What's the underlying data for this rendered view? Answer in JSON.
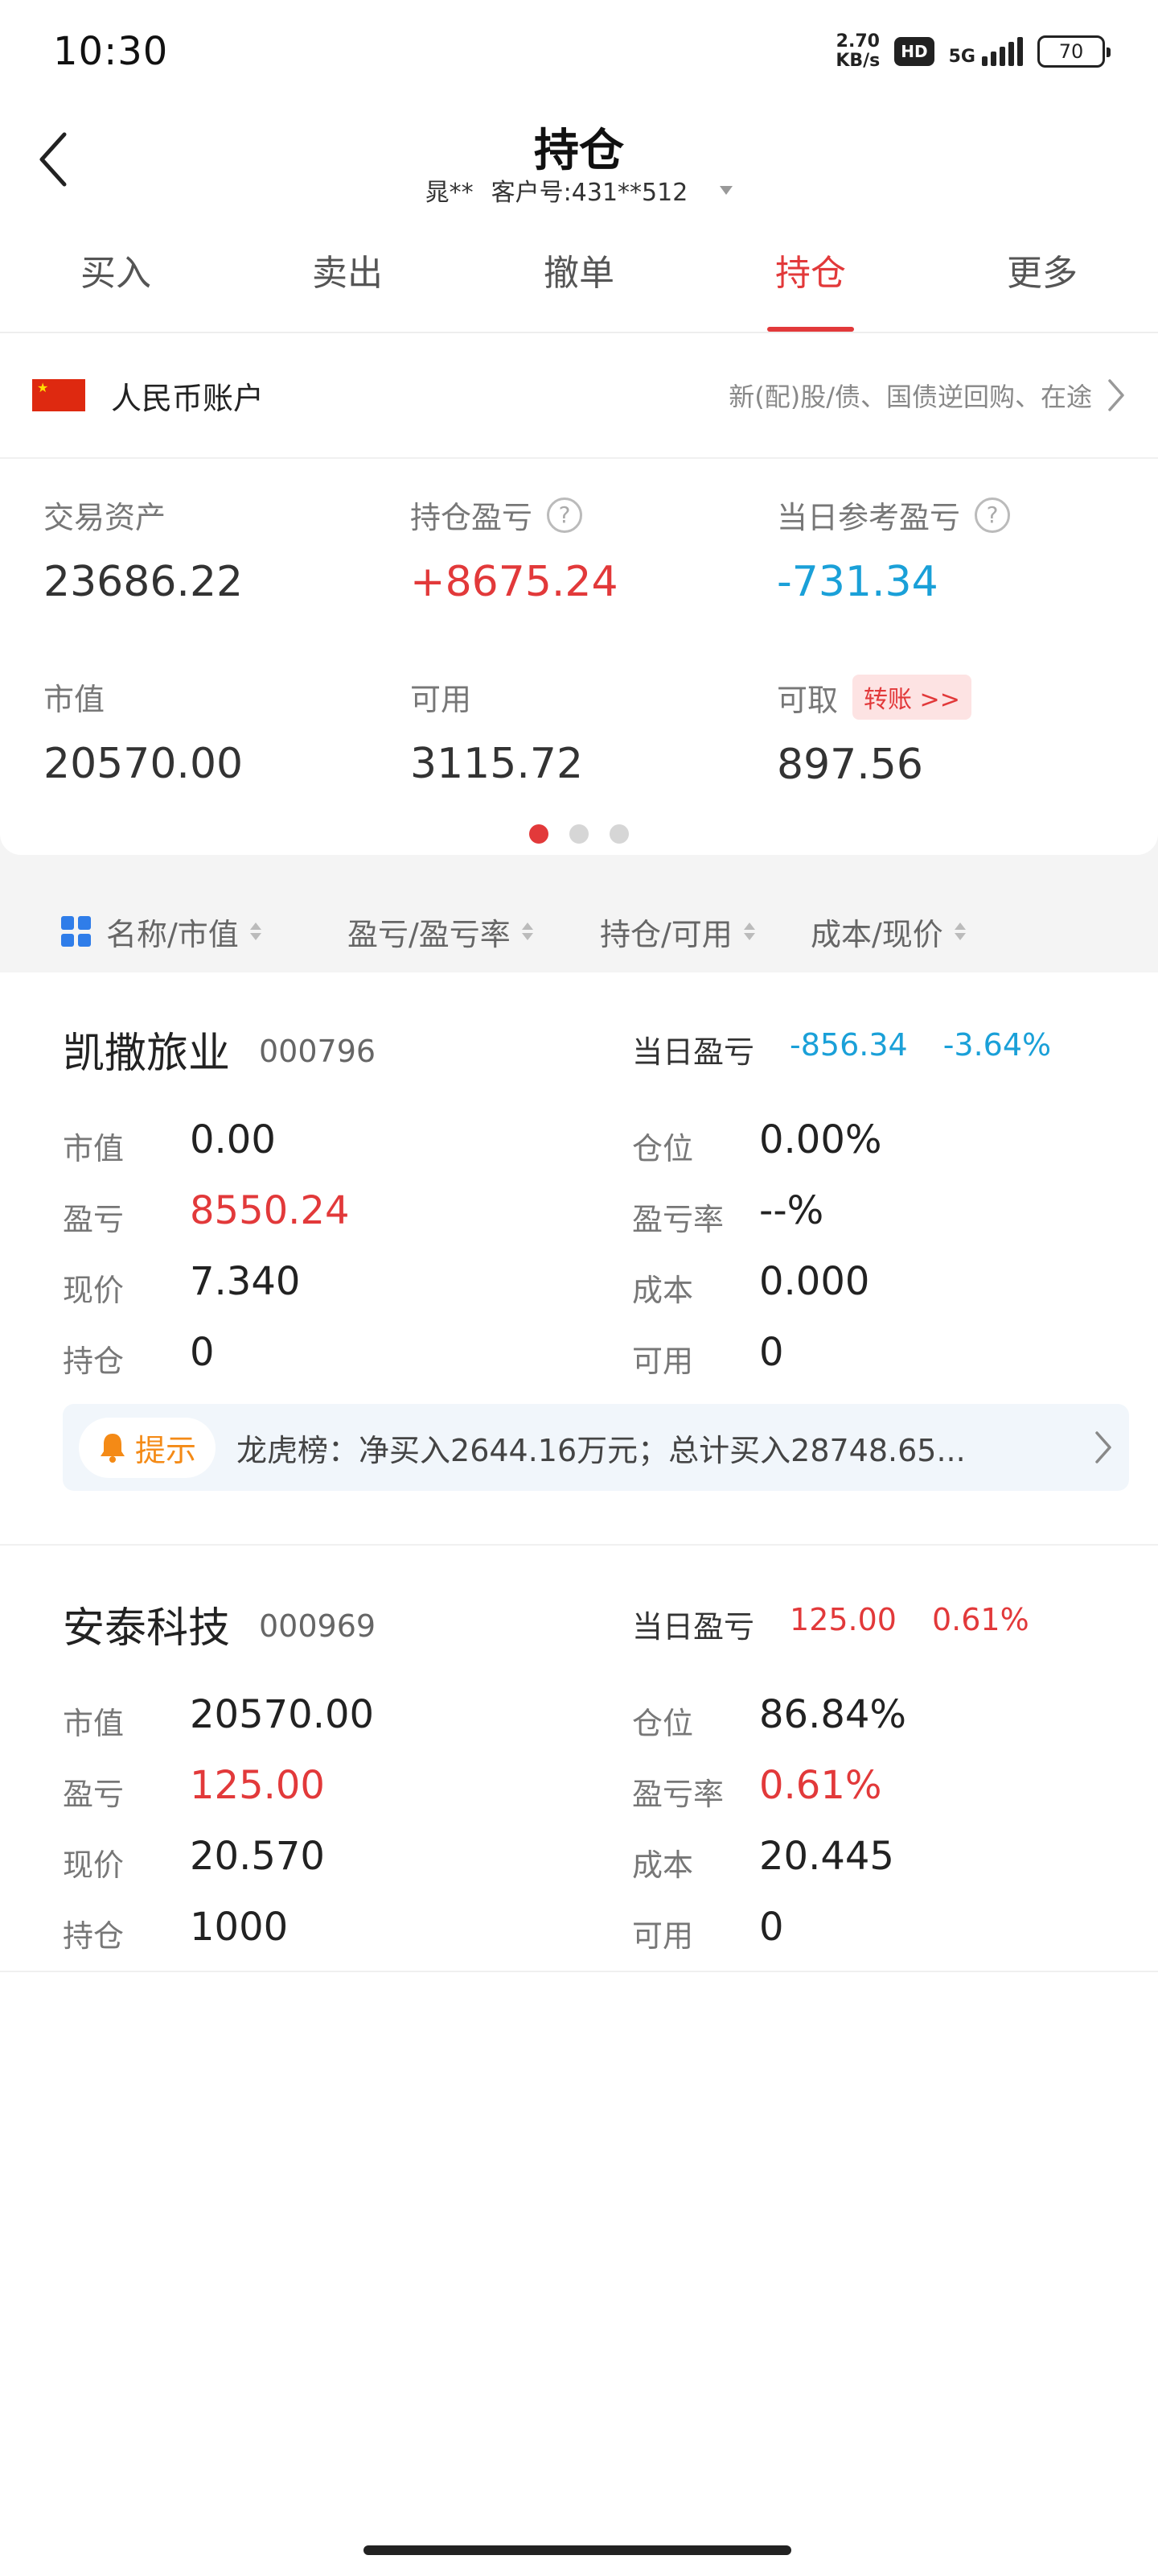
{
  "status_bar": {
    "time": "10:30",
    "net_speed_value": "2.70",
    "net_speed_unit": "KB/s",
    "hd": "HD",
    "signal": "5G",
    "battery": "70"
  },
  "header": {
    "title": "持仓",
    "user": "晁**",
    "customer_no": "客户号:431**512"
  },
  "tabs": [
    {
      "label": "买入"
    },
    {
      "label": "卖出"
    },
    {
      "label": "撤单"
    },
    {
      "label": "持仓",
      "active": true
    },
    {
      "label": "更多"
    }
  ],
  "account": {
    "name": "人民币账户",
    "right_text": "新(配)股/债、国债逆回购、在途",
    "metrics": {
      "trade_assets": {
        "label": "交易资产",
        "value": "23686.22"
      },
      "position_pl": {
        "label": "持仓盈亏",
        "value": "+8675.24"
      },
      "day_ref_pl": {
        "label": "当日参考盈亏",
        "value": "-731.34"
      },
      "market_value": {
        "label": "市值",
        "value": "20570.00"
      },
      "available": {
        "label": "可用",
        "value": "3115.72"
      },
      "withdrawable": {
        "label": "可取",
        "value": "897.56",
        "action": "转账 >>"
      }
    },
    "page_index": 0,
    "page_count": 3
  },
  "sort_header": {
    "col1": "名称/市值",
    "col2": "盈亏/盈亏率",
    "col3": "持仓/可用",
    "col4": "成本/现价"
  },
  "stocks": [
    {
      "name": "凯撒旅业",
      "code": "000796",
      "day_pl_label": "当日盈亏",
      "day_pl": "-856.34",
      "day_pl_pct": "-3.64%",
      "labels": {
        "mv": "市值",
        "pl": "盈亏",
        "price": "现价",
        "hold": "持仓",
        "pos": "仓位",
        "plr": "盈亏率",
        "cost": "成本",
        "avail": "可用"
      },
      "mv": "0.00",
      "pl": "8550.24",
      "price": "7.340",
      "hold": "0",
      "pos": "0.00%",
      "plr": "--%",
      "cost": "0.000",
      "avail": "0",
      "tip": {
        "badge": "提示",
        "text": "龙虎榜：净买入2644.16万元；总计买入28748.65..."
      }
    },
    {
      "name": "安泰科技",
      "code": "000969",
      "day_pl_label": "当日盈亏",
      "day_pl": "125.00",
      "day_pl_pct": "0.61%",
      "labels": {
        "mv": "市值",
        "pl": "盈亏",
        "price": "现价",
        "hold": "持仓",
        "pos": "仓位",
        "plr": "盈亏率",
        "cost": "成本",
        "avail": "可用"
      },
      "mv": "20570.00",
      "pl": "125.00",
      "price": "20.570",
      "hold": "1000",
      "pos": "86.84%",
      "plr": "0.61%",
      "cost": "20.445",
      "avail": "0"
    }
  ],
  "colors": {
    "accent_red": "#e2393a",
    "loss_blue": "#1aa0d8",
    "tip_orange": "#f48a16",
    "grid_blue": "#2f7de9"
  }
}
